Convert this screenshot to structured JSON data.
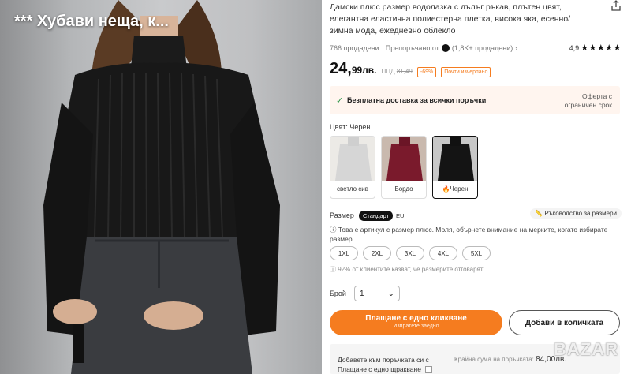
{
  "photo": {
    "overlay_title": "*** Хубави неща, к..."
  },
  "product": {
    "title": "Дамски плюс размер водолазка с дълъг ръкав, плътен цвят, елегантна еластична полиестерна плетка, висока яка, есенно/зимна мода, ежедневно облекло",
    "sold": "766 продадени",
    "seller_prefix": "Препоръчано от",
    "seller_suffix": "(1,8K+ продадени)",
    "rating_value": "4,9",
    "stars": "★★★★★"
  },
  "price": {
    "main": "24,",
    "cents": "99лв.",
    "old_label": "ПЦД",
    "old_value": "81,49",
    "discount": "-69%",
    "badge": "Почти изчерпано"
  },
  "shipping": {
    "text": "Безплатна доставка за всички поръчки",
    "right": "Оферта с ограничен срок"
  },
  "color": {
    "label": "Цвят: Черен",
    "options": [
      {
        "label": "светло сив",
        "color": "#d9d9d9"
      },
      {
        "label": "Бордо",
        "color": "#7a1a2c"
      },
      {
        "label": "Черен",
        "color": "#141414",
        "hot": "🔥"
      }
    ]
  },
  "size": {
    "label": "Размер",
    "tab_standard": "Стандарт",
    "tab_eu": "EU",
    "guide": "Ръководство за размери",
    "plus_note": "Това е артикул с размер плюс. Моля, обърнете внимание на мерките, когато избирате размер.",
    "options": [
      "1XL",
      "2XL",
      "3XL",
      "4XL",
      "5XL"
    ],
    "fit_note": "92% от клиентите казват, че размерите отговарят"
  },
  "quantity": {
    "label": "Брой",
    "value": "1"
  },
  "buttons": {
    "buy_main": "Плащане с едно кликване",
    "buy_sub": "Изпратете заедно",
    "add_to_cart": "Добави в количката"
  },
  "bottom": {
    "left_line1": "Добавете към поръчката си с",
    "left_line2": "Плащане с едно щракване",
    "right_label": "Крайна сума на поръчката:",
    "right_amount": "84,00лв."
  },
  "watermark": "BAZAR",
  "colors": {
    "accent": "#f57c1f",
    "success": "#1a8d3a",
    "ship_bg": "#fff5ef"
  }
}
